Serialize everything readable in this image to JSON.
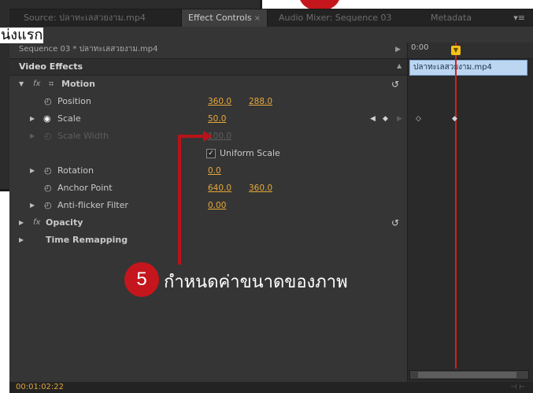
{
  "tabs": [
    {
      "label": "Source: ปลาทะเลสวยงาม.mp4"
    },
    {
      "label": "Effect Controls",
      "close": "×"
    },
    {
      "label": "Audio Mixer: Sequence 03"
    },
    {
      "label": "Metadata"
    }
  ],
  "panel_menu": "▾≡",
  "overlay_partial_text": "น่งแรก",
  "sequence_label": "Sequence 03 * ปลาทะเลสวยงาม.mp4",
  "video_effects_header": "Video Effects",
  "rows": {
    "motion": {
      "fx": "fx",
      "label": "Motion"
    },
    "position": {
      "label": "Position",
      "v1": "360.0",
      "v2": "288.0"
    },
    "scale": {
      "label": "Scale",
      "v1": "50.0"
    },
    "scale_width": {
      "label": "Scale Width",
      "v1": "100.0"
    },
    "uniform_scale": {
      "label": "Uniform Scale",
      "check": "✓"
    },
    "rotation": {
      "label": "Rotation",
      "v1": "0.0"
    },
    "anchor_point": {
      "label": "Anchor Point",
      "v1": "640.0",
      "v2": "360.0"
    },
    "anti_flicker": {
      "label": "Anti-flicker Filter",
      "v1": "0.00"
    },
    "opacity": {
      "fx": "fx",
      "label": "Opacity"
    },
    "time_remapping": {
      "label": "Time Remapping"
    }
  },
  "timeline": {
    "time": "0:00",
    "clip_name": "ปลาทะเลสวยงาม.mp4"
  },
  "status_time": "00:01:02:22",
  "callout": {
    "number": "5",
    "text": "กำหนดค่าขนาดของภาพ"
  }
}
